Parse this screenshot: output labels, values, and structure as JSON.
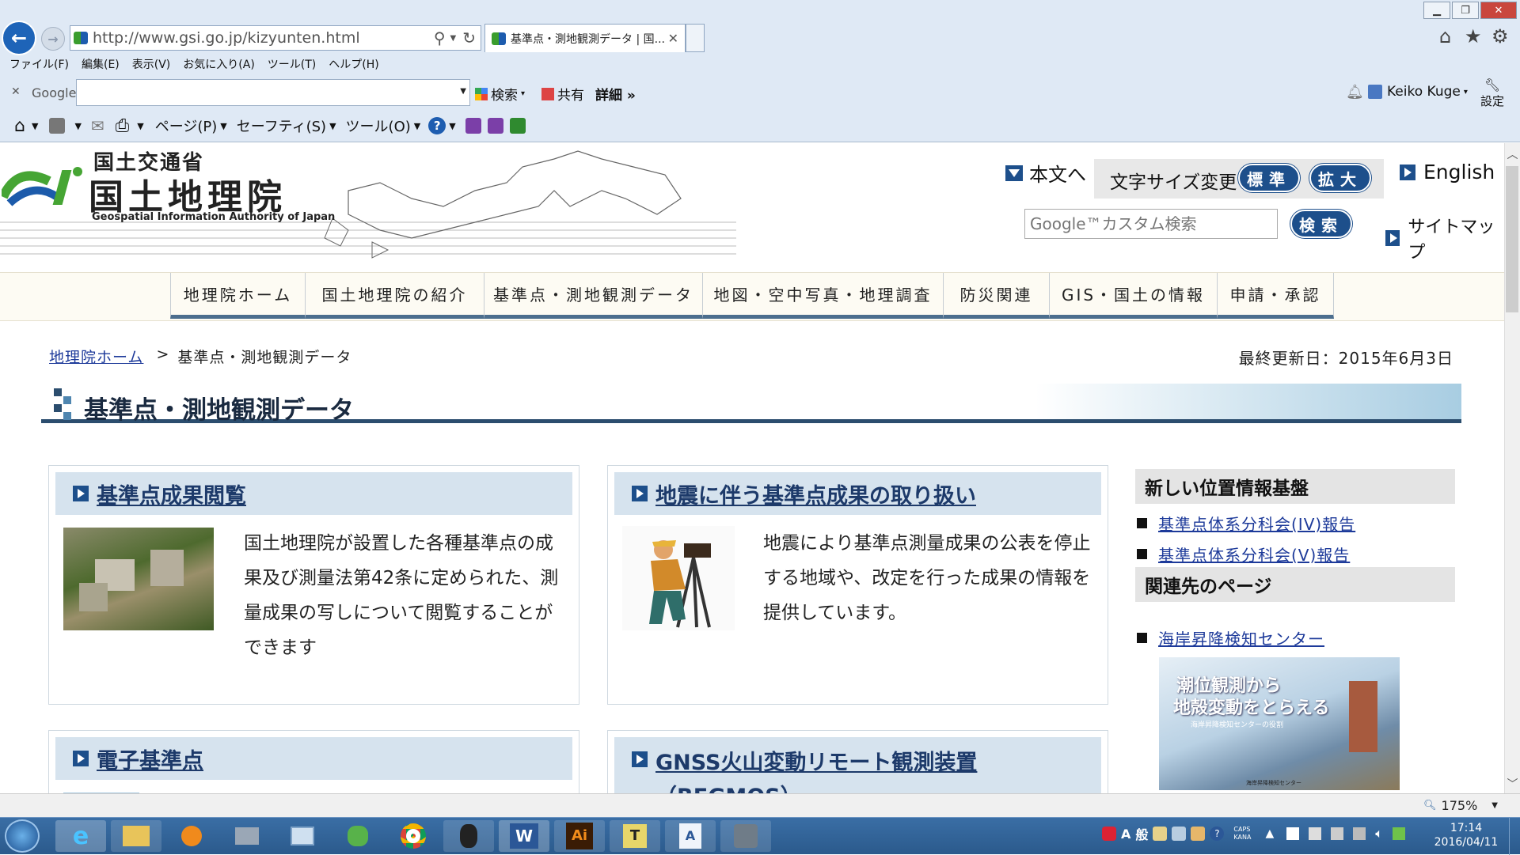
{
  "browser": {
    "url": "http://www.gsi.go.jp/kizyunten.html",
    "tab_title": "基準点・測地観測データ | 国...",
    "menu": [
      "ファイル(F)",
      "編集(E)",
      "表示(V)",
      "お気に入り(A)",
      "ツール(T)",
      "ヘルプ(H)"
    ],
    "google_label": "Google",
    "google_search_btn": "検索",
    "share_label": "共有",
    "more_label": "詳細 »",
    "user_name": "Keiko Kuge",
    "settings_label": "設定",
    "cmd_page": "ページ(P)",
    "cmd_safety": "セーフティ(S)",
    "cmd_tools": "ツール(O)",
    "zoom": "175%"
  },
  "site": {
    "ministry": "国土交通省",
    "org_name": "国土地理院",
    "org_en": "Geospatial Information Authority of Japan",
    "skip_link": "本文へ",
    "font_size_label": "文字サイズ変更",
    "font_standard": "標準",
    "font_large": "拡大",
    "english": "English",
    "search_placeholder": "Google™カスタム検索",
    "search_btn": "検索",
    "sitemap": "サイトマップ",
    "nav": [
      "地理院ホーム",
      "国土地理院の紹介",
      "基準点・測地観測データ",
      "地図・空中写真・地理調査",
      "防災関連",
      "GIS・国土の情報",
      "申請・承認"
    ]
  },
  "breadcrumb": {
    "home": "地理院ホーム",
    "sep": ">",
    "current": "基準点・測地観測データ"
  },
  "last_updated": "最終更新日：2015年6月3日",
  "page_title": "基準点・測地観測データ",
  "cards": [
    {
      "title": "基準点成果閲覧",
      "text": "国土地理院が設置した各種基準点の成果及び測量法第42条に定められた、測量成果の写しについて閲覧することができます"
    },
    {
      "title": "地震に伴う基準点成果の取り扱い",
      "text": "地震により基準点測量成果の公表を停止する地域や、改定を行った成果の情報を提供しています。"
    },
    {
      "title": "電子基準点",
      "text": ""
    },
    {
      "title": "GNSS火山変動リモート観測装置（REGMOS）",
      "title_line1": "GNSS火山変動リモート観測装置",
      "title_line2": "（REGMOS）",
      "text": ""
    }
  ],
  "sidebar": {
    "section1": "新しい位置情報基盤",
    "links1": [
      "基準点体系分科会(IV)報告",
      "基準点体系分科会(V)報告"
    ],
    "section2": "関連先のページ",
    "links2": [
      "海岸昇降検知センター"
    ],
    "banner_line1": "潮位観測から",
    "banner_line2": "地殻変動をとらえる",
    "banner_sub": "海岸昇降検知センターの役割",
    "banner_footer": "海岸昇降検知センター"
  },
  "taskbar": {
    "time": "17:14",
    "date": "2016/04/11",
    "ime_a": "A",
    "ime_mode": "般",
    "caps": "CAPS",
    "kana": "KANA"
  }
}
